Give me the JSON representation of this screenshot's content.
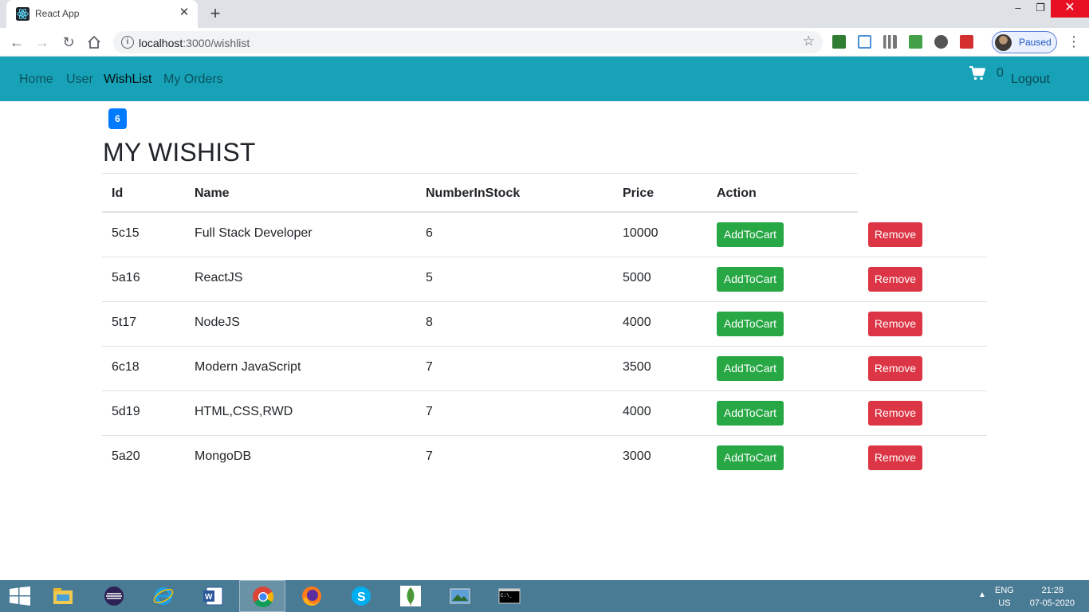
{
  "browser": {
    "tab_title": "React App",
    "url_host": "localhost",
    "url_rest": ":3000/wishlist",
    "profile_label": "Paused"
  },
  "navbar": {
    "links": [
      "Home",
      "User",
      "WishList",
      "My Orders"
    ],
    "active": "WishList",
    "cart_count": "0",
    "logout_label": "Logout",
    "bg_color": "#17a2b8"
  },
  "page": {
    "badge": "6",
    "title": "MY WISHIST"
  },
  "table": {
    "headers": [
      "Id",
      "Name",
      "NumberInStock",
      "Price",
      "Action"
    ],
    "add_label": "AddToCart",
    "remove_label": "Remove",
    "rows": [
      {
        "id": "5c15",
        "name": "Full Stack Developer",
        "stock": "6",
        "price": "10000"
      },
      {
        "id": "5a16",
        "name": "ReactJS",
        "stock": "5",
        "price": "5000"
      },
      {
        "id": "5t17",
        "name": "NodeJS",
        "stock": "8",
        "price": "4000"
      },
      {
        "id": "6c18",
        "name": "Modern JavaScript",
        "stock": "7",
        "price": "3500"
      },
      {
        "id": "5d19",
        "name": "HTML,CSS,RWD",
        "stock": "7",
        "price": "4000"
      },
      {
        "id": "5a20",
        "name": "MongoDB",
        "stock": "7",
        "price": "3000"
      }
    ],
    "add_color": "#28a745",
    "remove_color": "#dc3545"
  },
  "taskbar": {
    "apps": [
      "start-icon",
      "file-explorer-icon",
      "eclipse-icon",
      "internet-explorer-icon",
      "word-icon",
      "chrome-icon",
      "firefox-icon",
      "skype-icon",
      "mongodb-icon",
      "photo-viewer-icon",
      "command-prompt-icon"
    ],
    "lang_line1": "ENG",
    "lang_line2": "US",
    "time": "21:28",
    "date": "07-05-2020"
  }
}
